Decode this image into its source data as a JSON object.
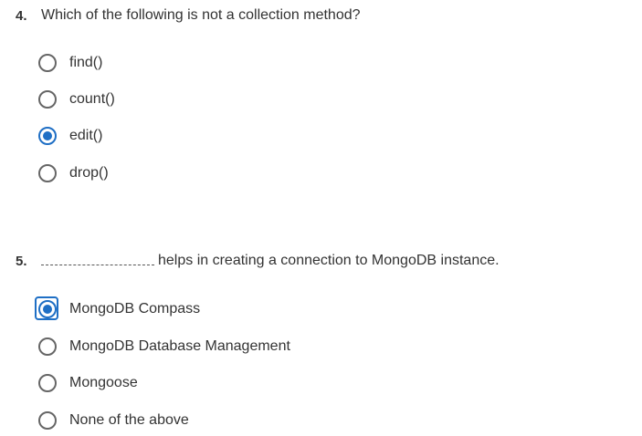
{
  "questions": [
    {
      "number": "4.",
      "text": "Which of the following is not a collection method?",
      "options": [
        {
          "label": "find()",
          "selected": false
        },
        {
          "label": "count()",
          "selected": false
        },
        {
          "label": "edit()",
          "selected": true
        },
        {
          "label": "drop()",
          "selected": false
        }
      ]
    },
    {
      "number": "5.",
      "text": "helps in creating a connection to MongoDB instance.",
      "options": [
        {
          "label": "MongoDB Compass",
          "selected": true
        },
        {
          "label": "MongoDB Database Management",
          "selected": false
        },
        {
          "label": "Mongoose",
          "selected": false
        },
        {
          "label": "None of the above",
          "selected": false
        }
      ]
    }
  ],
  "colors": {
    "accent": "#1f6fc5",
    "text": "#333333",
    "radio_border": "#666666"
  }
}
